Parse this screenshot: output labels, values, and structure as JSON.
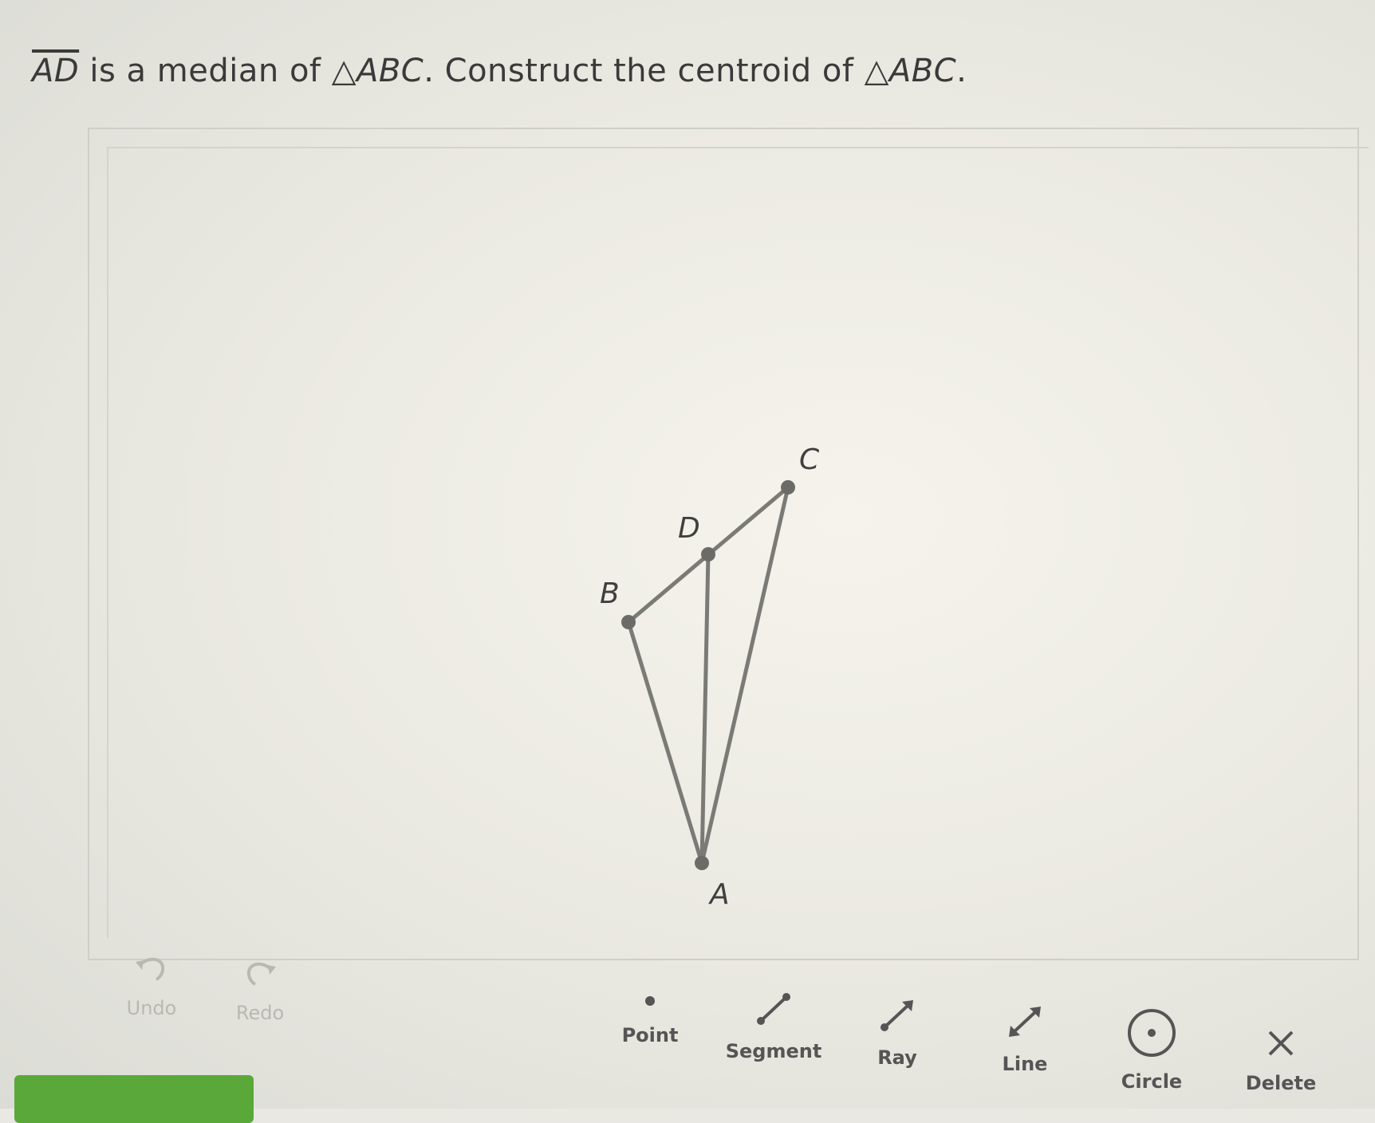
{
  "prompt": {
    "segment": "AD",
    "text1": " is a median of ",
    "triangle1": "△",
    "name1": "ABC",
    "text2": ". Construct the centroid of ",
    "triangle2": "△",
    "name2": "ABC",
    "end": "."
  },
  "points": {
    "A": "A",
    "B": "B",
    "C": "C",
    "D": "D"
  },
  "toolbar": {
    "undo": "Undo",
    "redo": "Redo",
    "point": "Point",
    "segment": "Segment",
    "ray": "Ray",
    "line": "Line",
    "circle": "Circle",
    "delete": "Delete"
  },
  "colors": {
    "accent": "#5aa83a",
    "stroke": "#7a7a76",
    "point": "#6b6b68"
  }
}
